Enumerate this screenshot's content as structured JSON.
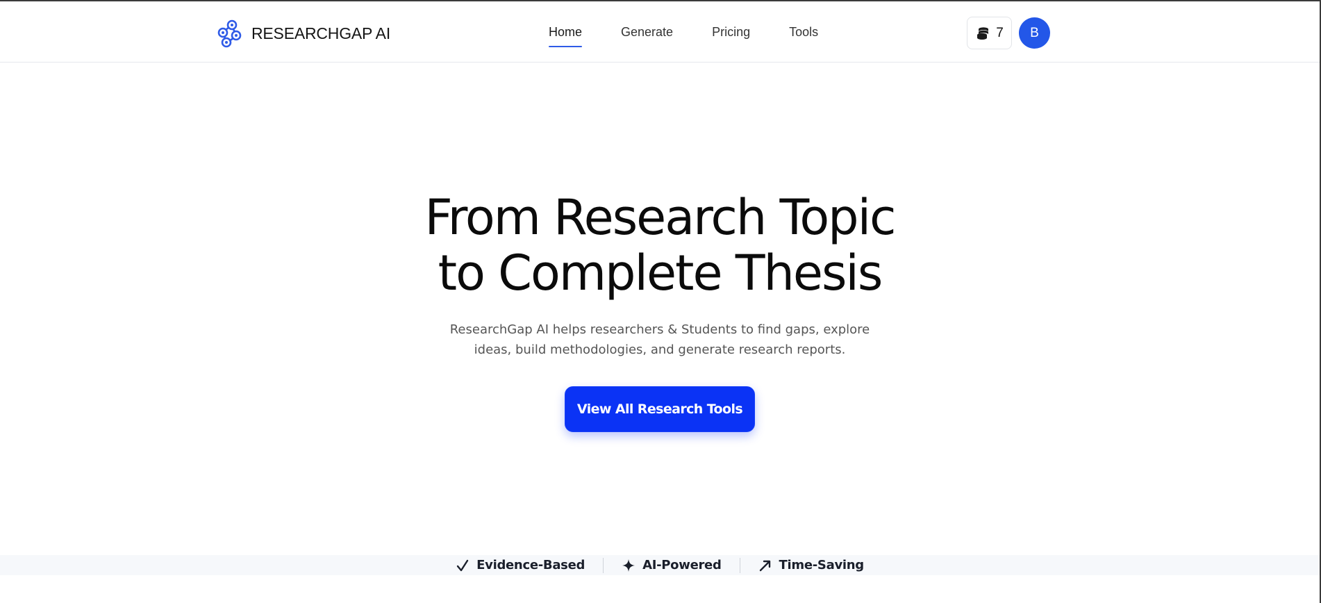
{
  "header": {
    "brand": "RESEARCHGAP AI",
    "logo_icon": "molecule-network-icon",
    "nav": [
      {
        "label": "Home",
        "active": true
      },
      {
        "label": "Generate",
        "active": false
      },
      {
        "label": "Pricing",
        "active": false
      },
      {
        "label": "Tools",
        "active": false
      }
    ],
    "credits": {
      "icon": "coins-stack-icon",
      "count": "7"
    },
    "avatar_initial": "B"
  },
  "hero": {
    "title_line1": "From Research Topic",
    "title_line2": "to Complete Thesis",
    "subtitle_line1": "ResearchGap AI helps researchers & Students to find gaps, explore",
    "subtitle_line2": "ideas, build methodologies, and generate research reports.",
    "cta_label": "View All Research Tools"
  },
  "features": [
    {
      "icon": "checkmark-icon",
      "label": "Evidence-Based"
    },
    {
      "icon": "sparkle-icon",
      "label": "AI-Powered"
    },
    {
      "icon": "trend-arrow-icon",
      "label": "Time-Saving"
    }
  ],
  "colors": {
    "accent": "#2357e8",
    "cta": "#0b33f5",
    "nav_underline": "#2f5be7"
  }
}
